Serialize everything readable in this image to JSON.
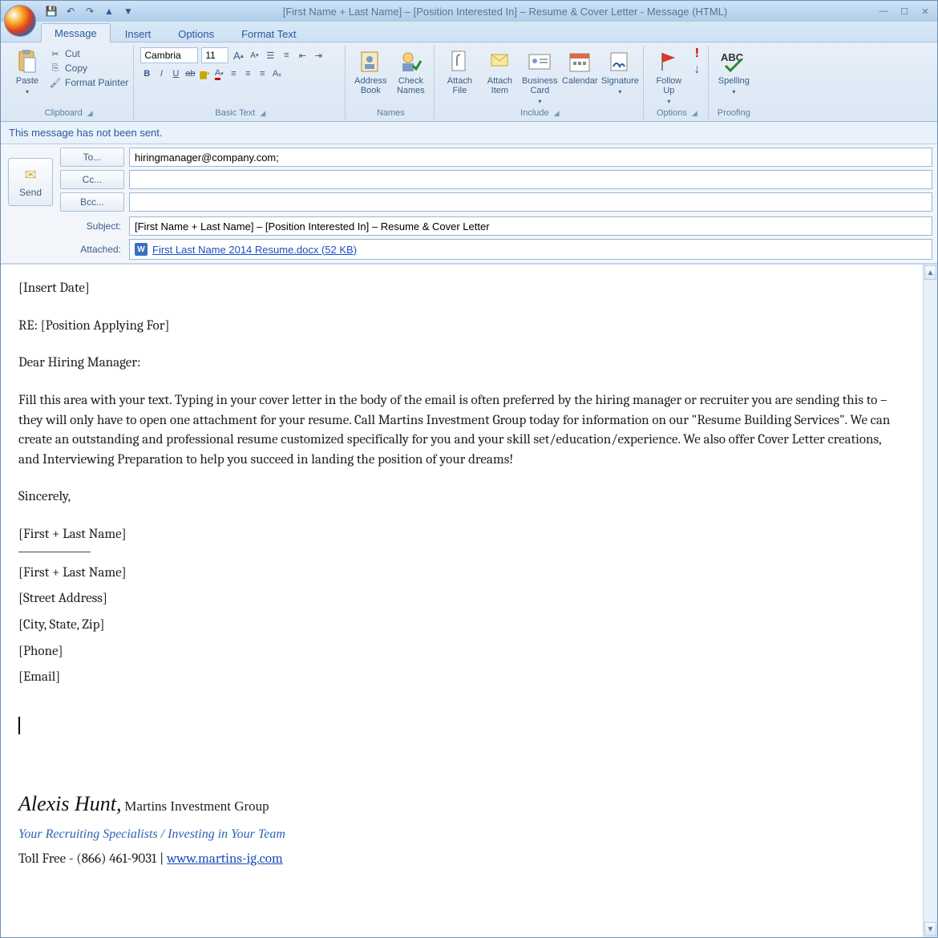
{
  "window": {
    "title": "[First Name + Last Name] – [Position Interested In] – Resume & Cover Letter - Message (HTML)"
  },
  "qat": {
    "save": "",
    "undo": "",
    "redo": "",
    "prev": "",
    "next": ""
  },
  "tabs": {
    "message": "Message",
    "insert": "Insert",
    "options": "Options",
    "format": "Format Text"
  },
  "ribbon": {
    "paste": "Paste",
    "cut": "Cut",
    "copy": "Copy",
    "format_painter": "Format Painter",
    "clipboard": "Clipboard",
    "font_name": "Cambria",
    "font_size": "11",
    "basic_text": "Basic Text",
    "address_book": "Address Book",
    "check_names": "Check Names",
    "names": "Names",
    "attach_file": "Attach File",
    "attach_item": "Attach Item",
    "business_card": "Business Card",
    "calendar": "Calendar",
    "signature": "Signature",
    "include": "Include",
    "follow_up": "Follow Up",
    "options": "Options",
    "spelling": "Spelling",
    "proofing": "Proofing"
  },
  "infobar": "This message has not been sent.",
  "header": {
    "send": "Send",
    "to_label": "To...",
    "to_value": "hiringmanager@company.com;",
    "cc_label": "Cc...",
    "cc_value": "",
    "bcc_label": "Bcc...",
    "bcc_value": "",
    "subject_label": "Subject:",
    "subject_value": "[First Name + Last Name] – [Position Interested In] – Resume & Cover Letter",
    "attached_label": "Attached:",
    "attached_value": "First Last Name 2014 Resume.docx (52 KB)"
  },
  "body": {
    "date": "[Insert Date]",
    "re": "RE: [Position Applying For]",
    "greeting": "Dear Hiring Manager:",
    "paragraph": "Fill this area with your text. Typing in your cover letter in the body of the email is often preferred by the hiring manager or recruiter you are sending this to – they will only have to open one attachment for your resume. Call Martins Investment Group today for information on our \"Resume Building Services\". We can create an outstanding and professional resume customized specifically for you and your skill set/education/experience. We also offer Cover Letter creations, and Interviewing Preparation to help you succeed in landing the position of your dreams!",
    "closing": "Sincerely,",
    "name_line": "[First + Last Name]",
    "addr1": "[First + Last Name]",
    "addr2": "[Street Address]",
    "addr3": "[City, State, Zip]",
    "addr4": "[Phone]",
    "addr5": "[Email]",
    "sig_name": "Alexis Hunt,",
    "sig_company": " Martins Investment Group",
    "sig_tag": "Your Recruiting Specialists / Investing in Your Team",
    "sig_toll": "Toll Free - (866) 461-9031 | ",
    "sig_link": "www.martins-ig.com"
  }
}
